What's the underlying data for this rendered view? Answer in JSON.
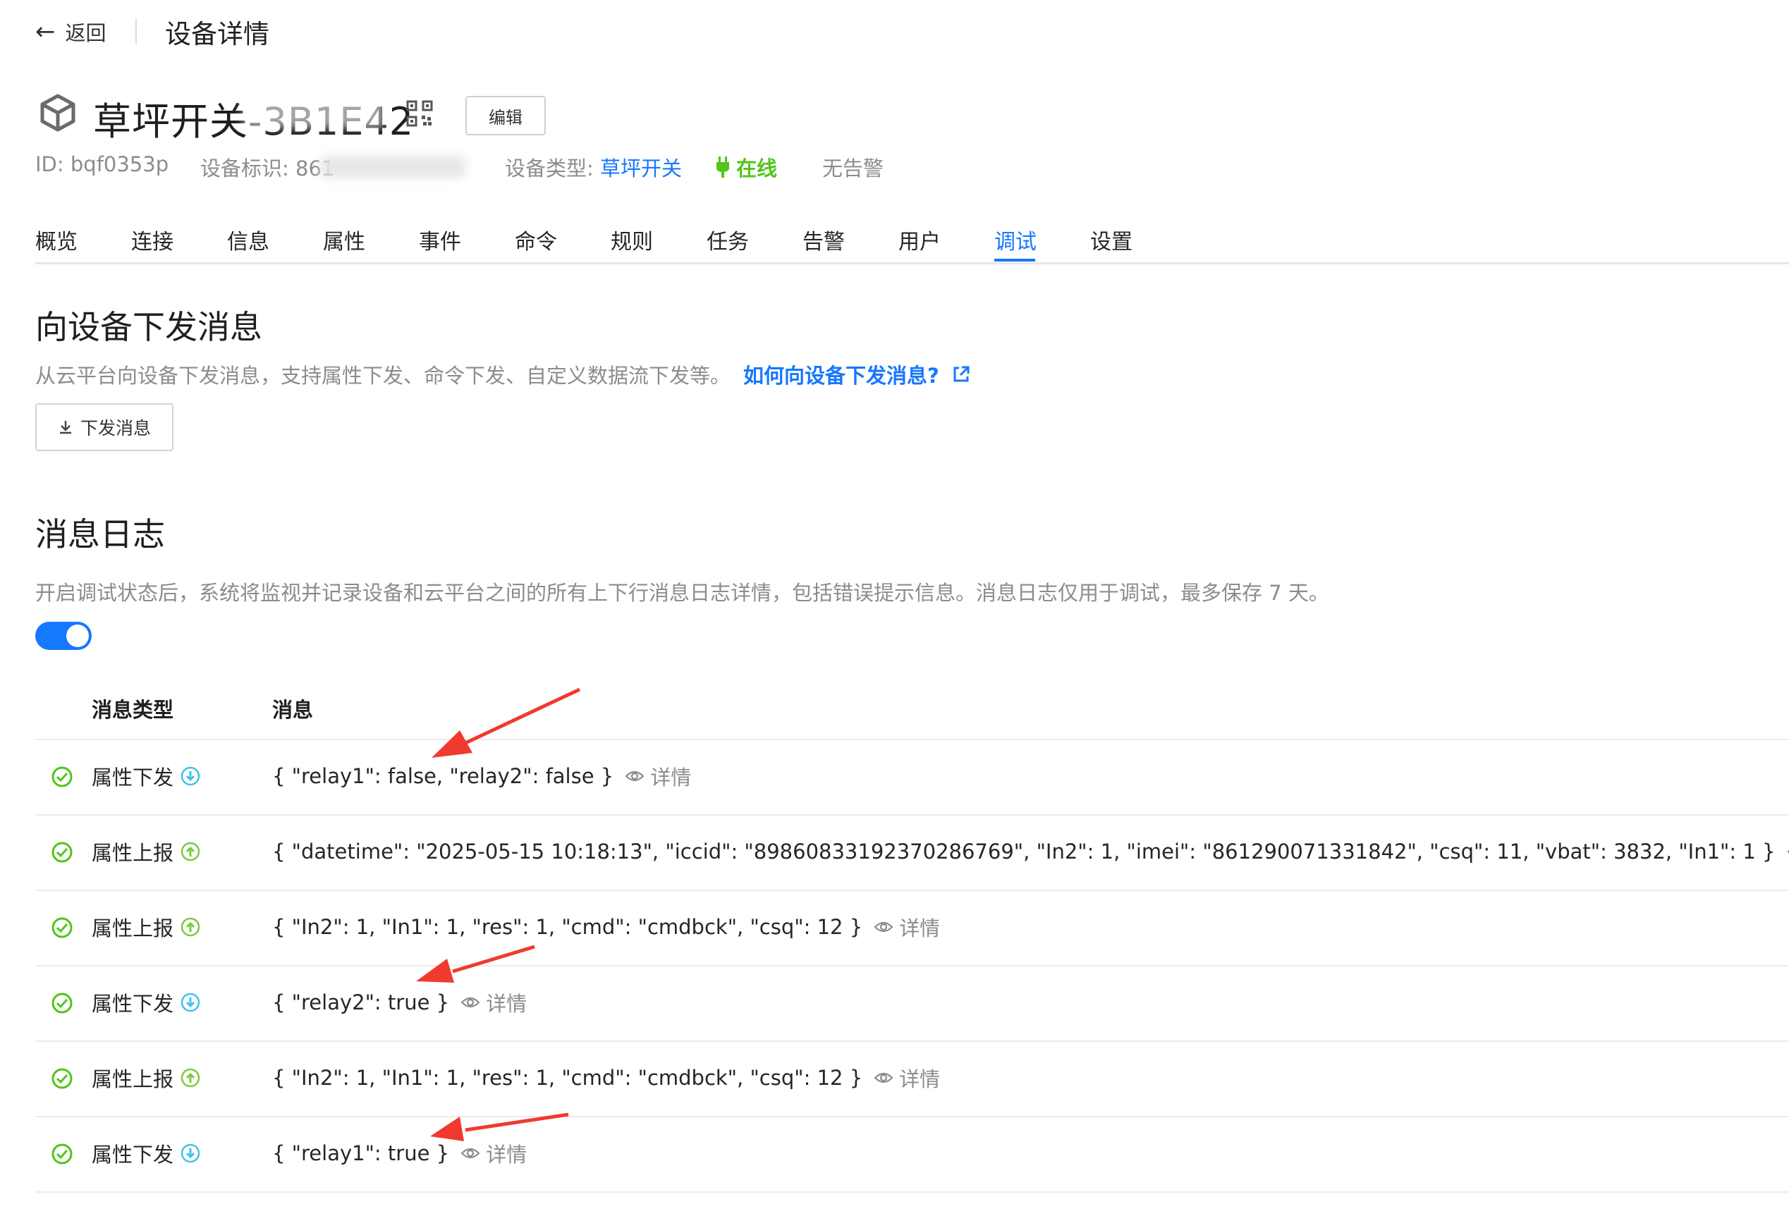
{
  "topbar": {
    "back_label": "返回",
    "title": "设备详情"
  },
  "device": {
    "name": "草坪开关-3B1E42",
    "edit_label": "编辑",
    "id_label": "ID: bqf0353p",
    "identifier_label": "设备标识: 861",
    "type_prefix": "设备类型: ",
    "type_value": "草坪开关",
    "status": "在线",
    "alarm": "无告警"
  },
  "tabs": [
    "概览",
    "连接",
    "信息",
    "属性",
    "事件",
    "命令",
    "规则",
    "任务",
    "告警",
    "用户",
    "调试",
    "设置"
  ],
  "active_tab": "调试",
  "send_section": {
    "title": "向设备下发消息",
    "desc": "从云平台向设备下发消息，支持属性下发、命令下发、自定义数据流下发等。",
    "help_link": "如何向设备下发消息?",
    "button": "下发消息"
  },
  "log_section": {
    "title": "消息日志",
    "desc": "开启调试状态后，系统将监视并记录设备和云平台之间的所有上下行消息日志详情，包括错误提示信息。消息日志仅用于调试，最多保存 7 天。",
    "toggle_on": true
  },
  "table": {
    "col_type": "消息类型",
    "col_msg": "消息",
    "detail_label": "详情",
    "rows": [
      {
        "type": "属性下发",
        "direction": "down",
        "message": "{ \"relay1\": false, \"relay2\": false }"
      },
      {
        "type": "属性上报",
        "direction": "up",
        "message": "{ \"datetime\": \"2025-05-15 10:18:13\", \"iccid\": \"89860833192370286769\", \"In2\": 1, \"imei\": \"861290071331842\", \"csq\": 11, \"vbat\": 3832, \"In1\": 1 }"
      },
      {
        "type": "属性上报",
        "direction": "up",
        "message": "{ \"In2\": 1, \"In1\": 1, \"res\": 1, \"cmd\": \"cmdbck\", \"csq\": 12 }"
      },
      {
        "type": "属性下发",
        "direction": "down",
        "message": "{ \"relay2\": true }"
      },
      {
        "type": "属性上报",
        "direction": "up",
        "message": "{ \"In2\": 1, \"In1\": 1, \"res\": 1, \"cmd\": \"cmdbck\", \"csq\": 12 }"
      },
      {
        "type": "属性下发",
        "direction": "down",
        "message": "{ \"relay1\": true }"
      }
    ]
  },
  "colors": {
    "accent": "#1677ff",
    "success": "#52c41a",
    "down_icon": "#40c4e8",
    "up_icon": "#7cc93e",
    "annotation": "#f03a2e"
  }
}
